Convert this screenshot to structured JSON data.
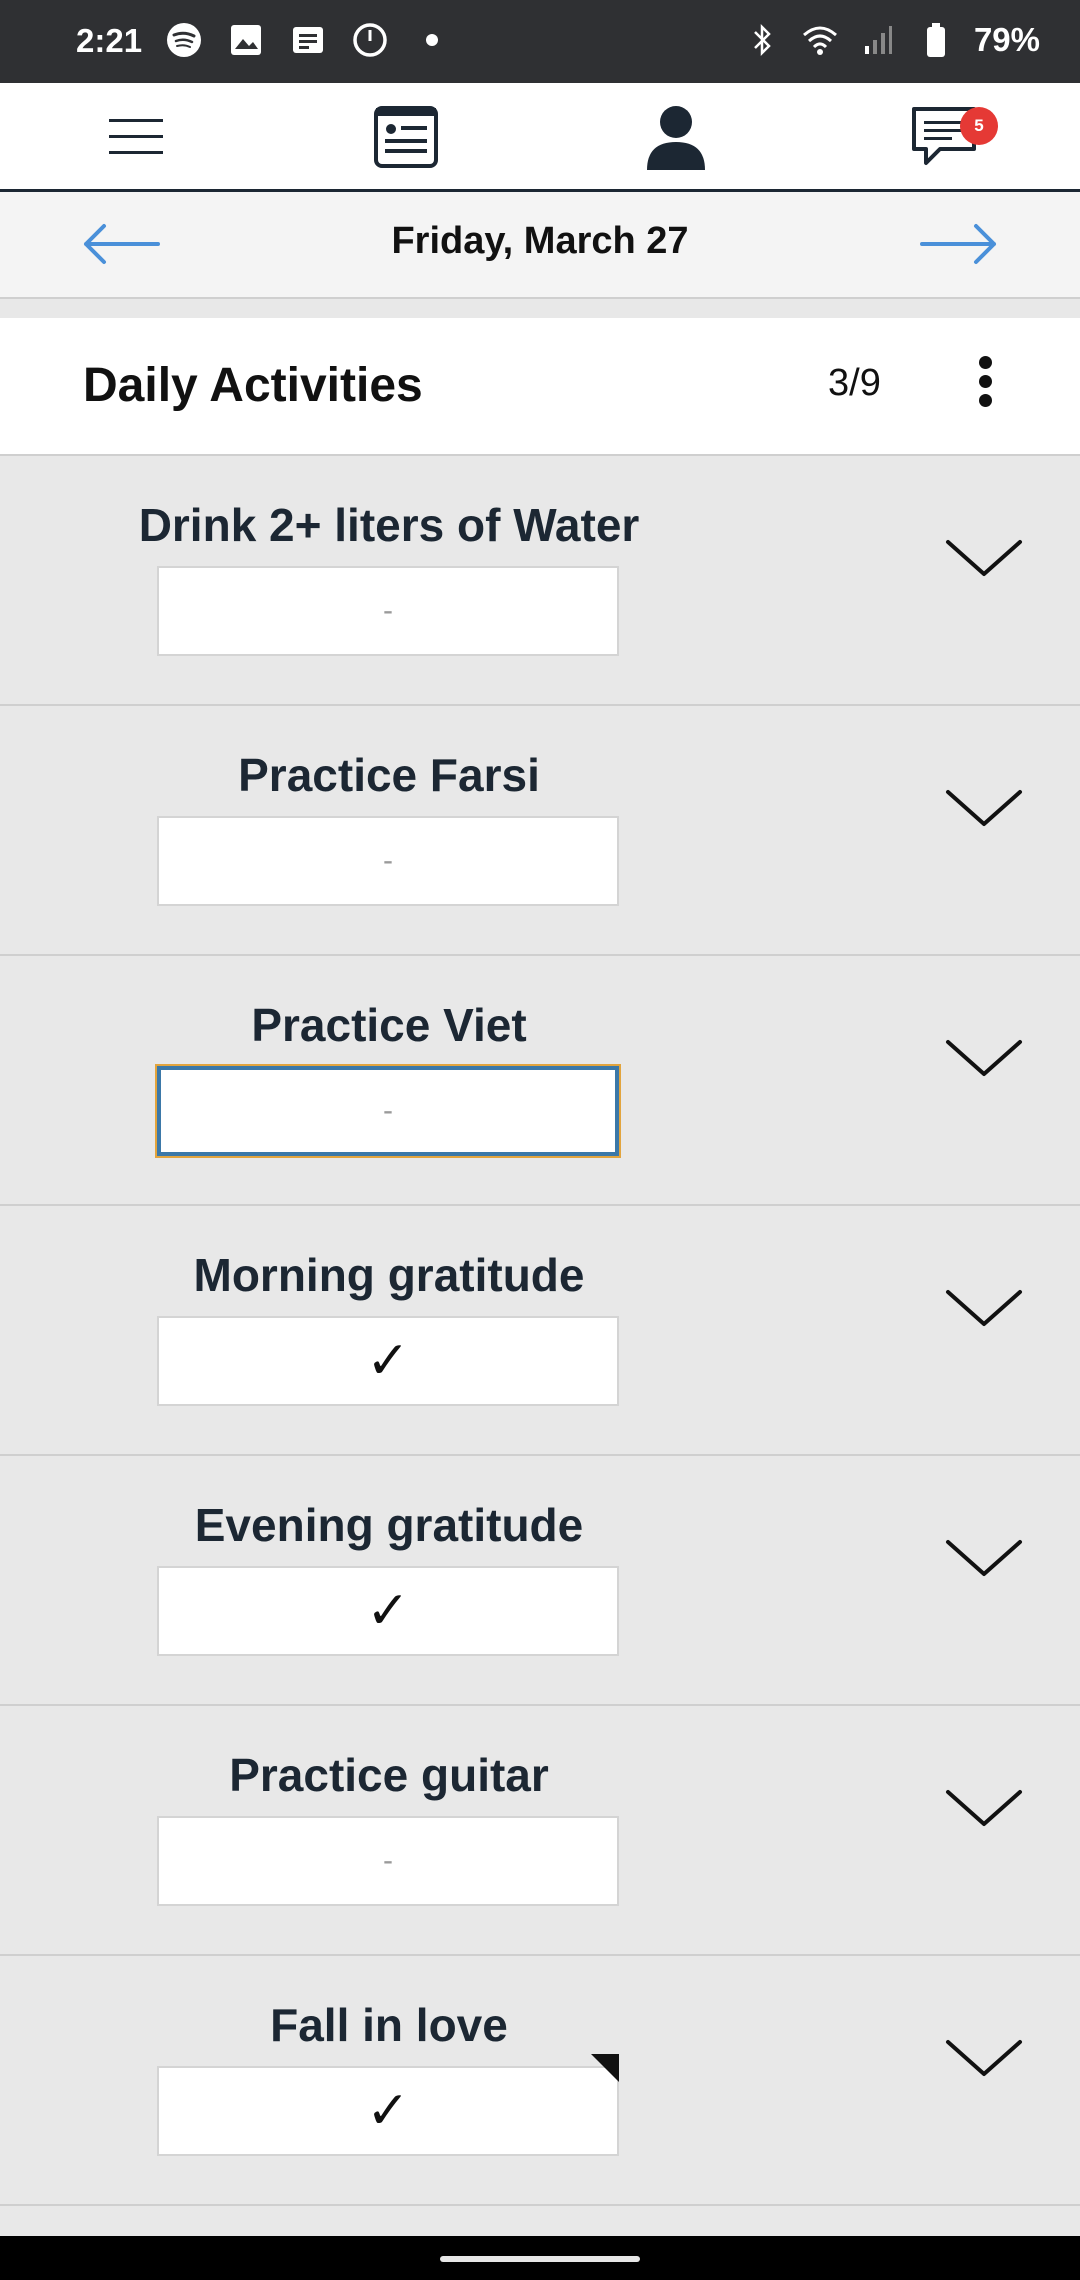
{
  "status_bar": {
    "time": "2:21",
    "battery": "79%",
    "left_icons": [
      "spotify-icon",
      "gallery-icon",
      "note-icon",
      "timer-icon",
      "dot-icon"
    ],
    "right_icons": [
      "bluetooth-icon",
      "wifi-icon",
      "signal-icon",
      "battery-icon"
    ]
  },
  "nav": {
    "items": [
      "menu-icon",
      "card-icon",
      "profile-icon",
      "messages-icon"
    ],
    "messages_badge": "5"
  },
  "date_bar": {
    "date": "Friday, March 27",
    "accent": "#4a90d9"
  },
  "card": {
    "title": "Daily Activities",
    "count": "3/9"
  },
  "activities": [
    {
      "title": "Drink 2+ liters of Water",
      "value": "-",
      "checked": false
    },
    {
      "title": "Practice Farsi",
      "value": "-",
      "checked": false
    },
    {
      "title": "Practice Viet",
      "value": "-",
      "checked": false,
      "focused": true
    },
    {
      "title": "Morning gratitude",
      "value": "✓",
      "checked": true
    },
    {
      "title": "Evening gratitude",
      "value": "✓",
      "checked": true
    },
    {
      "title": "Practice guitar",
      "value": "-",
      "checked": false
    },
    {
      "title": "Fall in love",
      "value": "✓",
      "checked": true,
      "has_note_flag": true
    }
  ]
}
